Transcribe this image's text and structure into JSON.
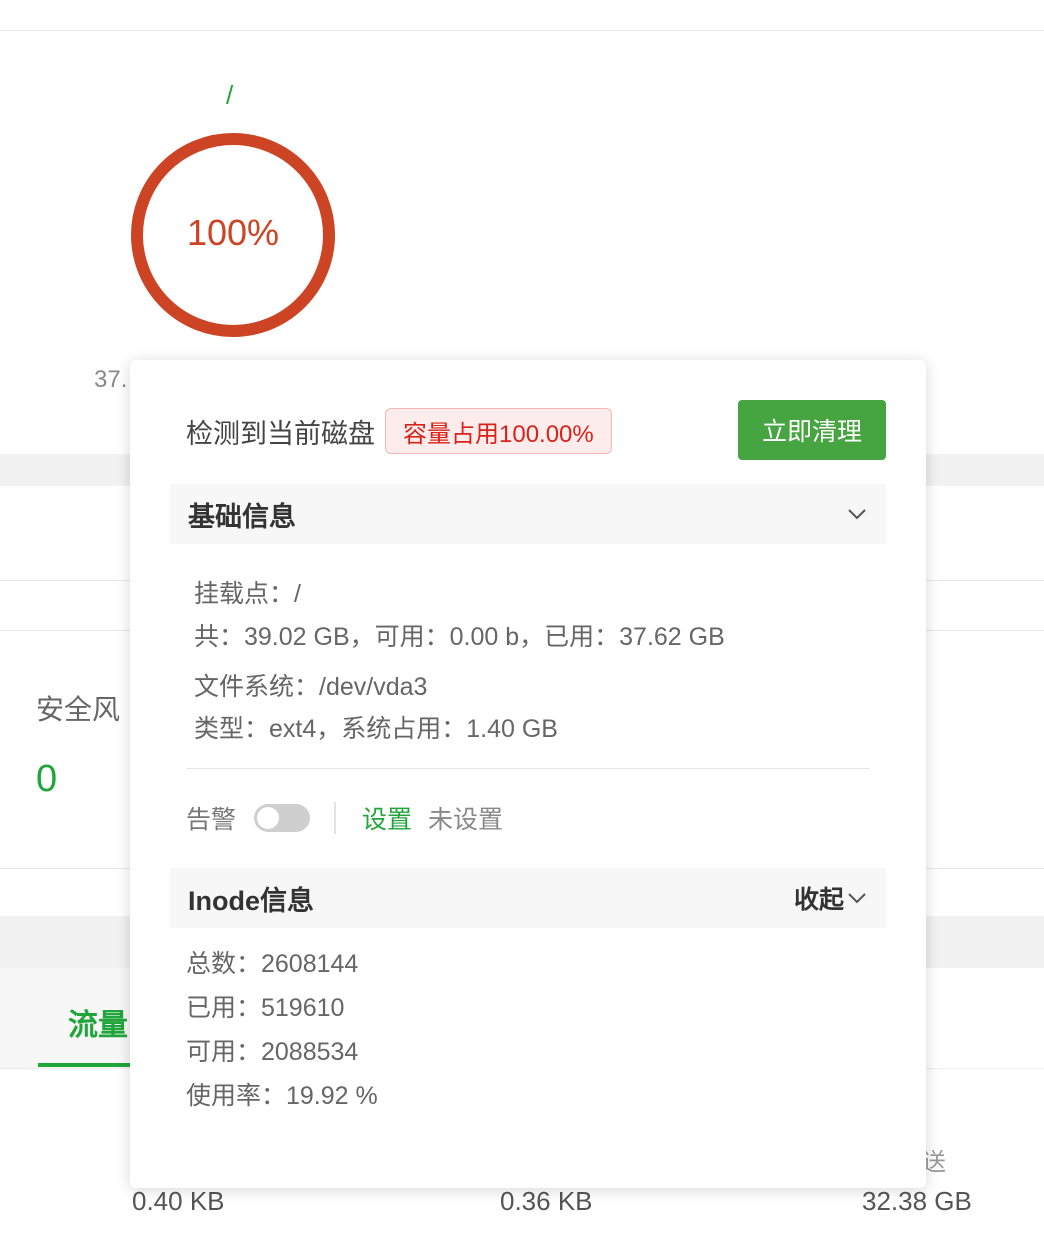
{
  "background": {
    "mount_point": "/",
    "gauge_percent": 100,
    "gauge_text": "100%",
    "gauge_color": "#cc4424",
    "under_gauge_text": "37.",
    "risk_label": "安全风",
    "risk_value": "0",
    "traffic_tab": "流量",
    "stats": [
      "0.40 KB",
      "0.36 KB",
      "32.38 GB"
    ],
    "send_label": "送"
  },
  "popover": {
    "detect_text": "检测到当前磁盘",
    "usage_badge": "容量占用100.00%",
    "clean_button": "立即清理",
    "basic_info": {
      "title": "基础信息",
      "mount_line": "挂载点：/",
      "size_line": "共：39.02 GB，可用：0.00 b，已用：37.62 GB",
      "fs_line": "文件系统：/dev/vda3",
      "type_line": "类型：ext4，系统占用：1.40 GB"
    },
    "alert": {
      "label": "告警",
      "enabled": false,
      "settings_link": "设置",
      "status": "未设置"
    },
    "inode_info": {
      "title": "Inode信息",
      "collapse_label": "收起",
      "total_line": "总数：2608144",
      "used_line": "已用：519610",
      "free_line": "可用：2088534",
      "rate_line": "使用率：19.92 %"
    }
  },
  "colors": {
    "brand_green": "#20a53a",
    "button_green": "#46a441",
    "danger_red": "#d9221a"
  }
}
